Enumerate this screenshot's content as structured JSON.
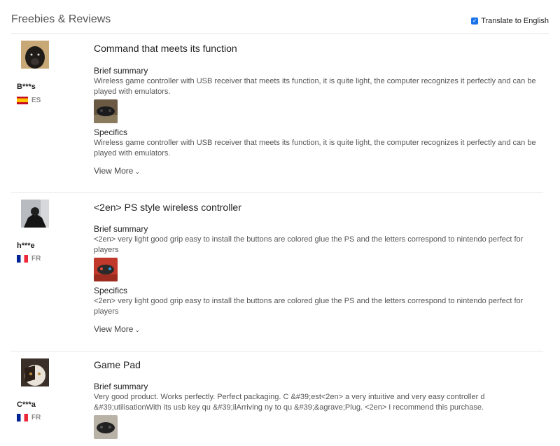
{
  "header": {
    "title": "Freebies & Reviews",
    "translate_label": "Translate to English",
    "translate_checked": true
  },
  "reviews": [
    {
      "user": "B***s",
      "country": "ES",
      "flag": "spain-flag",
      "title": "Command that meets its function",
      "summary_label": "Brief summary",
      "summary": "Wireless game controller with USB receiver that meets its function, it is quite light, the computer recognizes it perfectly and can be played with emulators.",
      "specifics_label": "Specifics",
      "specifics": "Wireless game controller with USB receiver that meets its function, it is quite light, the computer recognizes it perfectly and can be played with emulators.",
      "view_more": "View More"
    },
    {
      "user": "h***e",
      "country": "FR",
      "flag": "france-flag",
      "title": "<2en> PS style wireless controller",
      "summary_label": "Brief summary",
      "summary": "<2en> very light good grip easy to install the buttons are colored glue the PS and the letters correspond to nintendo perfect for players",
      "specifics_label": "Specifics",
      "specifics": "<2en> very light good grip easy to install the buttons are colored glue the PS and the letters correspond to nintendo perfect for players",
      "view_more": "View More"
    },
    {
      "user": "C***a",
      "country": "FR",
      "flag": "france-flag",
      "title": "Game Pad",
      "summary_label": "Brief summary",
      "summary": "Very good product. Works perfectly. Perfect packaging. C &#39;est<2en> a very intuitive and very easy controller d &#39;utilisationWith its usb key qu &#39;ilArriving ny to qu &#39;&agrave;Plug. <2en> I recommend this purchase."
    }
  ]
}
